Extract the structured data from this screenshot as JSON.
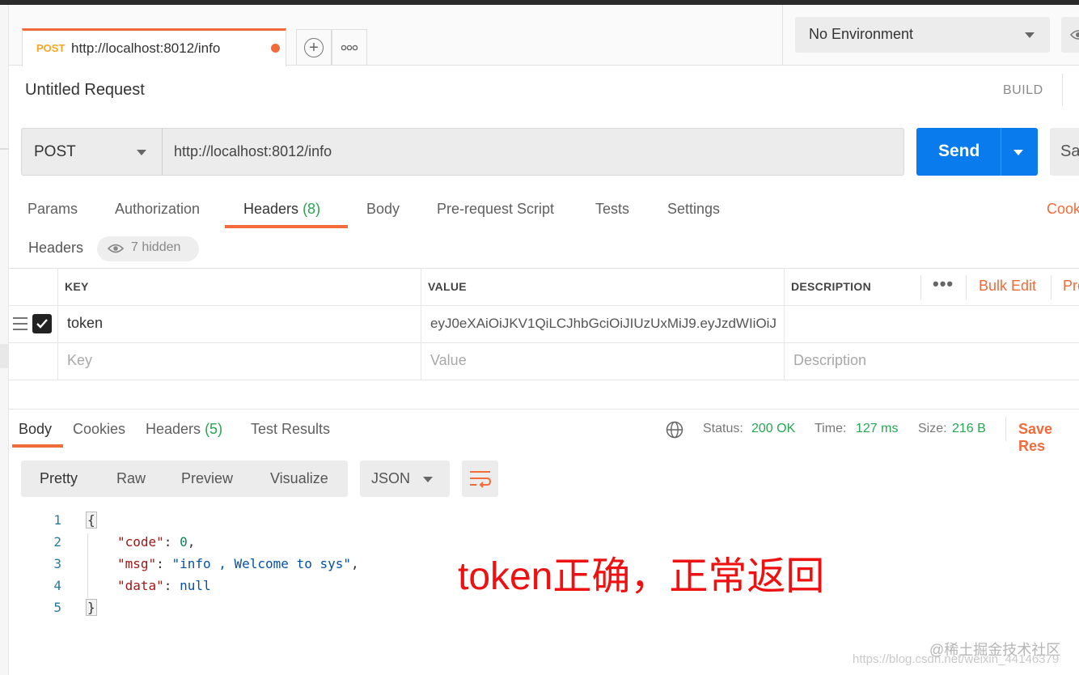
{
  "tab": {
    "method": "POST",
    "url": "http://localhost:8012/info"
  },
  "env": {
    "selected": "No Environment"
  },
  "request": {
    "title": "Untitled Request",
    "build_label": "BUILD",
    "method": "POST",
    "url": "http://localhost:8012/info",
    "send_label": "Send",
    "save_label": "Sa"
  },
  "req_tabs": [
    {
      "label": "Params"
    },
    {
      "label": "Authorization"
    },
    {
      "label": "Headers",
      "count": "(8)"
    },
    {
      "label": "Body"
    },
    {
      "label": "Pre-request Script"
    },
    {
      "label": "Tests"
    },
    {
      "label": "Settings"
    }
  ],
  "cookies_link": "Cook",
  "headers_section": {
    "label": "Headers",
    "hidden": "7 hidden"
  },
  "table": {
    "columns": [
      "KEY",
      "VALUE",
      "DESCRIPTION"
    ],
    "bulk_edit": "Bulk Edit",
    "presets": "Pre",
    "rows": [
      {
        "key": "token",
        "value": "eyJ0eXAiOiJKV1QiLCJhbGciOiJIUzUxMiJ9.eyJzdWIiOiJ",
        "description": ""
      }
    ],
    "placeholders": {
      "key": "Key",
      "value": "Value",
      "description": "Description"
    }
  },
  "response_tabs": [
    {
      "label": "Body"
    },
    {
      "label": "Cookies"
    },
    {
      "label": "Headers",
      "count": "(5)"
    },
    {
      "label": "Test Results"
    }
  ],
  "status": {
    "status_label": "Status:",
    "status_value": "200 OK",
    "time_label": "Time:",
    "time_value": "127 ms",
    "size_label": "Size:",
    "size_value": "216 B",
    "save_response": "Save Res"
  },
  "format_tabs": [
    "Pretty",
    "Raw",
    "Preview",
    "Visualize"
  ],
  "language": "JSON",
  "code": {
    "line_numbers": [
      "1",
      "2",
      "3",
      "4",
      "5"
    ],
    "open": "{",
    "close": "}",
    "pairs": [
      {
        "key": "\"code\"",
        "value": "0",
        "comma": ","
      },
      {
        "key": "\"msg\"",
        "value": "\"info , Welcome to sys\"",
        "comma": ","
      },
      {
        "key": "\"data\"",
        "value": "null",
        "comma": ""
      }
    ]
  },
  "annotation": "token正确，正常返回",
  "watermark": {
    "line1": "@稀土掘金技术社区",
    "line2": "https://blog.csdn.net/weixin_44146379"
  },
  "colors": {
    "accent": "#f26b3a",
    "send": "#097bed",
    "success": "#26a650",
    "annotation": "#ee1111"
  }
}
